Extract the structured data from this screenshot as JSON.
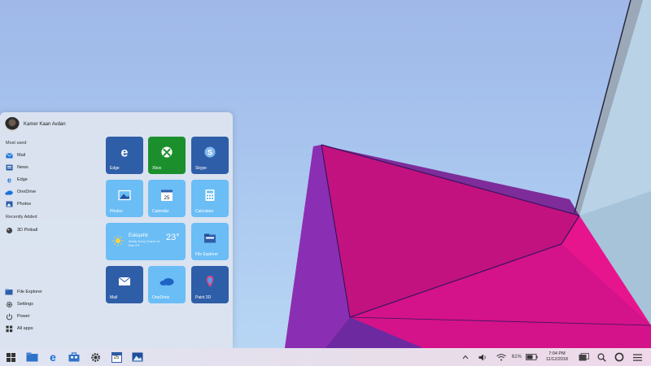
{
  "start_menu": {
    "user_name": "Kamer Kaan Avdan",
    "most_used_label": "Most used",
    "recently_added_label": "Recently Added",
    "most_used": [
      {
        "label": "Mail",
        "icon": "mail-icon"
      },
      {
        "label": "News",
        "icon": "news-icon"
      },
      {
        "label": "Edge",
        "icon": "edge-icon"
      },
      {
        "label": "OneDrive",
        "icon": "onedrive-icon"
      },
      {
        "label": "Photos",
        "icon": "photos-icon"
      }
    ],
    "recently_added": [
      {
        "label": "3D Pinball",
        "icon": "pinball-icon"
      }
    ],
    "bottom": [
      {
        "label": "File Explorer",
        "icon": "folder-icon"
      },
      {
        "label": "Settings",
        "icon": "gear-icon"
      },
      {
        "label": "Power",
        "icon": "power-icon"
      },
      {
        "label": "All apps",
        "icon": "grid-icon"
      }
    ],
    "tiles": {
      "edge": "Edge",
      "xbox": "Xbox",
      "skype": "Skype",
      "photos": "Photos",
      "calendar": "Calendar",
      "calendar_day": "25",
      "calculator": "Calculator",
      "file_explorer": "File Explorer",
      "mail": "Mail",
      "onedrive": "OneDrive",
      "paint3d": "Paint 3D"
    },
    "weather": {
      "city": "Eskişehir",
      "desc": "Mostly Sunny Chance of Rain 0%",
      "temp": "23°"
    }
  },
  "taskbar": {
    "battery": "61%",
    "time": "7:04 PM",
    "date": "11/12/2018",
    "calendar_day": "25"
  },
  "colors": {
    "tile_dark": "#2f5ea8",
    "tile_light": "#6bbdf5",
    "xbox_green": "#1c8f2d",
    "accent": "#1a73d9"
  }
}
